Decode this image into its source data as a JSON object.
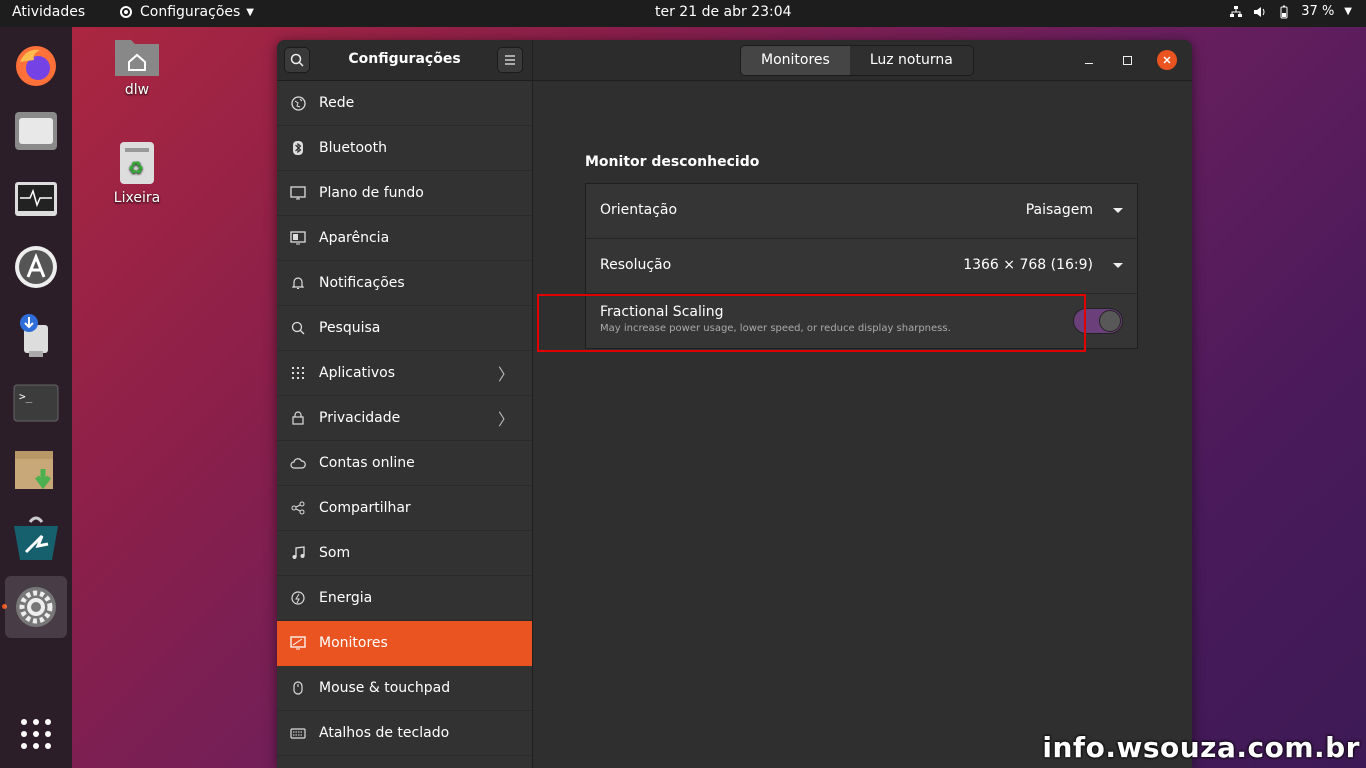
{
  "topbar": {
    "activities": "Atividades",
    "app_name": "Configurações",
    "clock": "ter 21 de abr  23:04",
    "battery": "37 %"
  },
  "desktop": {
    "icons": [
      {
        "label": "dlw"
      },
      {
        "label": "Lixeira"
      }
    ]
  },
  "dock": {
    "items": [
      "firefox",
      "files",
      "system-monitor",
      "software-center",
      "usb-creator",
      "terminal",
      "archive-manager",
      "store",
      "settings"
    ]
  },
  "window": {
    "sidebar_title": "Configurações",
    "sidebar": {
      "items": [
        {
          "label": "Rede",
          "icon": "network-icon"
        },
        {
          "label": "Bluetooth",
          "icon": "bluetooth-icon"
        },
        {
          "label": "Plano de fundo",
          "icon": "background-icon"
        },
        {
          "label": "Aparência",
          "icon": "appearance-icon"
        },
        {
          "label": "Notificações",
          "icon": "bell-icon"
        },
        {
          "label": "Pesquisa",
          "icon": "search-icon"
        },
        {
          "label": "Aplicativos",
          "icon": "apps-icon"
        },
        {
          "label": "Privacidade",
          "icon": "lock-icon"
        },
        {
          "label": "Contas online",
          "icon": "cloud-icon"
        },
        {
          "label": "Compartilhar",
          "icon": "share-icon"
        },
        {
          "label": "Som",
          "icon": "music-icon"
        },
        {
          "label": "Energia",
          "icon": "power-icon"
        },
        {
          "label": "Monitores",
          "icon": "display-icon"
        },
        {
          "label": "Mouse & touchpad",
          "icon": "mouse-icon"
        },
        {
          "label": "Atalhos de teclado",
          "icon": "keyboard-icon"
        }
      ],
      "selected": "Monitores"
    },
    "tabs": [
      "Monitores",
      "Luz noturna"
    ],
    "content": {
      "section_title": "Monitor desconhecido",
      "orientation_label": "Orientação",
      "orientation_value": "Paisagem",
      "resolution_label": "Resolução",
      "resolution_value": "1366 × 768 (16:9)",
      "fractional_title": "Fractional Scaling",
      "fractional_subtitle": "May increase power usage, lower speed, or reduce display sharpness.",
      "fractional_enabled": true
    }
  },
  "watermark": "info.wsouza.com.br",
  "colors": {
    "accent": "#e95420",
    "switch_on": "#6b3f7a",
    "highlight_border": "#e00000"
  }
}
